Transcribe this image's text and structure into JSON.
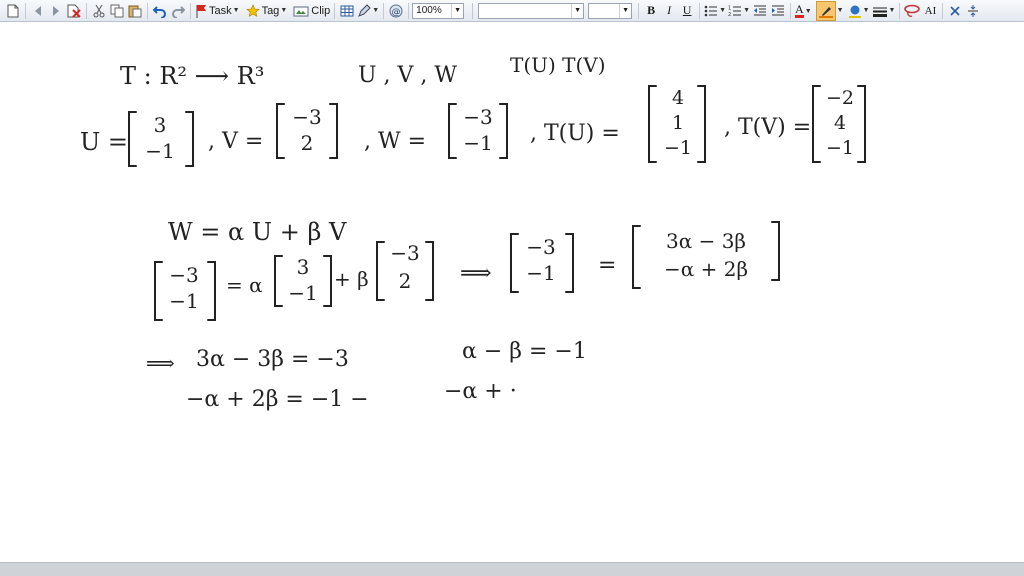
{
  "toolbar": {
    "task_label": "Task",
    "tag_label": "Tag",
    "clip_label": "Clip",
    "zoom_value": "100%",
    "bold": "B",
    "italic": "I",
    "underline": "U",
    "font_color_glyph": "A",
    "style_glyph": "AI",
    "highlight_color": "#f5a623",
    "icons": [
      "new-page-icon",
      "back-icon",
      "forward-icon",
      "delete-page-icon",
      "cut-icon",
      "copy-icon",
      "paste-icon",
      "undo-icon",
      "redo-icon",
      "task-flag-icon",
      "tag-star-icon",
      "clip-icon",
      "table-icon",
      "pen-icon",
      "at-icon",
      "bullets-icon",
      "numbering-icon",
      "outdent-icon",
      "indent-icon",
      "highlighter-icon",
      "fill-color-icon",
      "line-style-icon",
      "lasso-icon",
      "close-icon",
      "split-icon"
    ]
  },
  "notes": {
    "line1": [
      "T : R² ⟶ R³",
      "U , V , W",
      "T(U)  T(V)"
    ],
    "vec_u": {
      "label": "U =",
      "entries": [
        "3",
        "−1"
      ]
    },
    "vec_v": {
      "label": ", V =",
      "entries": [
        "−3",
        "2"
      ]
    },
    "vec_w": {
      "label": ", W =",
      "entries": [
        "−3",
        "−1"
      ]
    },
    "tu": {
      "label": ", T(U) =",
      "entries": [
        "4",
        "1",
        "−1"
      ]
    },
    "tv": {
      "label": ", T(V) =",
      "entries": [
        "−2",
        "4",
        "−1"
      ]
    },
    "eq_comb": "W = α U + β V",
    "eq2": {
      "lhs": [
        "−3",
        "−1"
      ],
      "a_coef": "= α",
      "a_vec": [
        "3",
        "−1"
      ],
      "b_coef": "+ β",
      "b_vec": [
        "−3",
        "2"
      ],
      "implies": "⟹",
      "mid": [
        "−3",
        "−1"
      ],
      "eq": "=",
      "rhs": [
        "3α − 3β",
        "−α  + 2β"
      ]
    },
    "sys1_implies": "⟹",
    "sys1": "3α − 3β = −3",
    "sys1b": "α − β = −1",
    "sys2": "−α + 2β = −1 −",
    "sys2b": "−α + ·"
  }
}
